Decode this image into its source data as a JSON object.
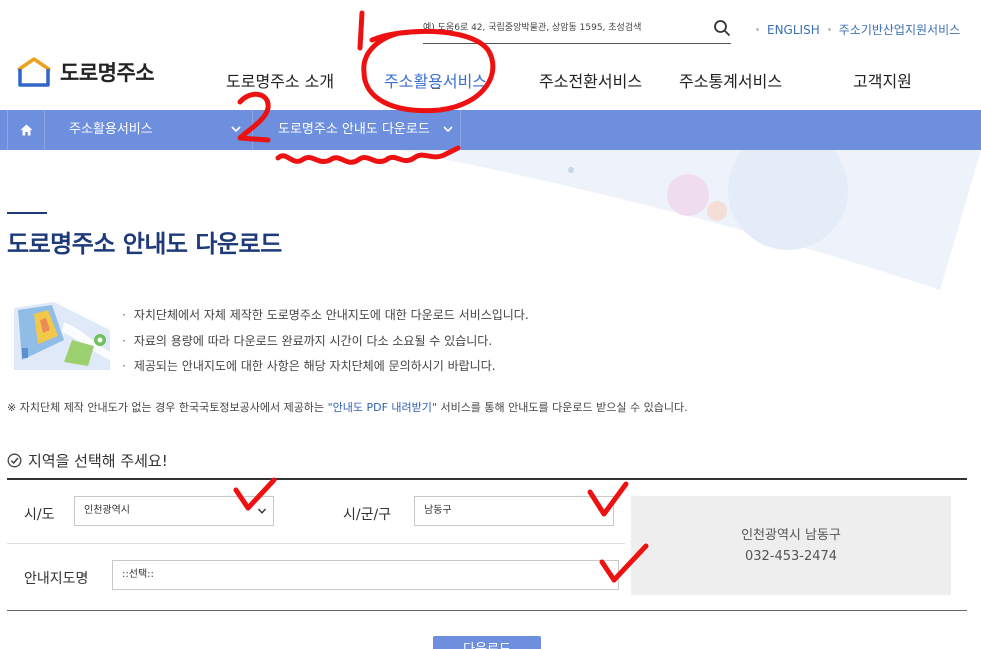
{
  "header": {
    "search": {
      "placeholder": "예) 도움6로 42, 국립중앙박물관, 상암동 1595, 초성검색"
    },
    "util_links": [
      "ENGLISH",
      "주소기반산업지원서비스"
    ],
    "logo_text": "도로명주소",
    "gnb": [
      "도로명주소 소개",
      "주소활용서비스",
      "주소전환서비스",
      "주소통계서비스",
      "고객지원"
    ],
    "gnb_active_index": 1
  },
  "breadcrumb": {
    "level1": "주소활용서비스",
    "level2": "도로명주소 안내도 다운로드"
  },
  "page": {
    "title": "도로명주소 안내도 다운로드",
    "info": [
      "자치단체에서 자체 제작한 도로명주소 안내지도에 대한 다운로드 서비스입니다.",
      "자료의 용량에 따라 다운로드 완료까지 시간이 다소 소요될 수 있습니다.",
      "제공되는 안내지도에 대한 사항은 해당 자치단체에 문의하시기 바랍니다."
    ],
    "note_prefix": "※ 자치단체 제작 안내도가 없는 경우 한국국토정보공사에서 제공하는 ",
    "note_link": "\"안내도 PDF 내려받기\"",
    "note_suffix": " 서비스를 통해 안내도를 다운로드 받으실 수 있습니다."
  },
  "region": {
    "heading": "지역을 선택해 주세요!",
    "sido_label": "시/도",
    "sido_value": "인천광역시",
    "sigungu_label": "시/군/구",
    "sigungu_value": "남동구",
    "map_label": "안내지도명",
    "map_value": "::선택::",
    "contact_name": "인천광역시 남동구",
    "contact_phone": "032-453-2474"
  },
  "submit_label": "다운로드",
  "annotations": {
    "mark_1": "1",
    "mark_2": "2",
    "color": "#ee1111"
  },
  "colors": {
    "accent": "#6e8fdd",
    "title": "#1e3a7a",
    "link": "#3b6fb6"
  }
}
